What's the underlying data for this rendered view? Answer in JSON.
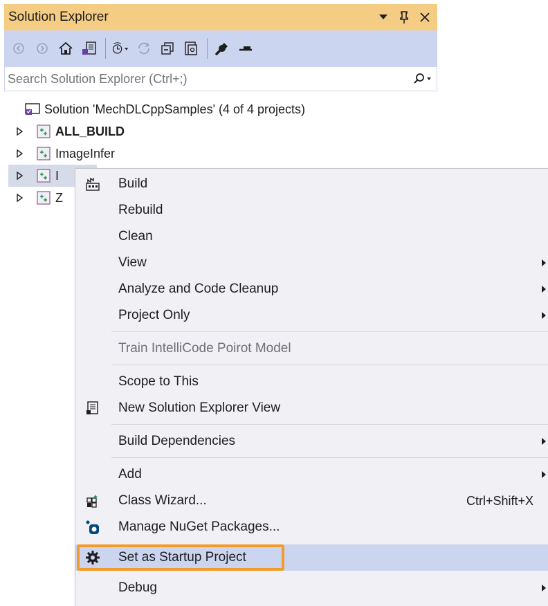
{
  "panel": {
    "title": "Solution Explorer",
    "colors": {
      "title_bar": "#f5cc84",
      "toolbar": "#ccd5f0",
      "menu_bg": "#f0f0f5",
      "highlight_border": "#f39a2a"
    }
  },
  "toolbar": {
    "icons": [
      "back-icon",
      "forward-icon",
      "home-icon",
      "switch-views-icon",
      "pending-changes-filter-icon",
      "refresh-icon",
      "collapse-all-icon",
      "show-all-files-icon",
      "properties-icon",
      "preview-icon"
    ]
  },
  "search": {
    "placeholder": "Search Solution Explorer (Ctrl+;)"
  },
  "tree": {
    "solution_label": "Solution 'MechDLCppSamples' (4 of 4 projects)",
    "projects": [
      {
        "name": "ALL_BUILD",
        "bold": true
      },
      {
        "name": "ImageInfer",
        "bold": false
      },
      {
        "name": "I",
        "bold": false
      },
      {
        "name": "Z",
        "bold": false
      }
    ]
  },
  "context_menu": {
    "items": [
      {
        "label": "Build",
        "icon": "build-icon"
      },
      {
        "label": "Rebuild"
      },
      {
        "label": "Clean"
      },
      {
        "label": "View",
        "submenu": true
      },
      {
        "label": "Analyze and Code Cleanup",
        "submenu": true
      },
      {
        "label": "Project Only",
        "submenu": true
      },
      {
        "label": "Train IntelliCode Poirot Model",
        "disabled": true
      },
      {
        "label": "Scope to This"
      },
      {
        "label": "New Solution Explorer View",
        "icon": "new-view-icon"
      },
      {
        "label": "Build Dependencies",
        "submenu": true
      },
      {
        "label": "Add",
        "submenu": true
      },
      {
        "label": "Class Wizard...",
        "icon": "class-wizard-icon",
        "shortcut": "Ctrl+Shift+X"
      },
      {
        "label": "Manage NuGet Packages...",
        "icon": "nuget-icon"
      },
      {
        "label": "Set as Startup Project",
        "icon": "gear-icon",
        "highlighted": true
      },
      {
        "label": "Debug",
        "submenu": true
      }
    ]
  }
}
